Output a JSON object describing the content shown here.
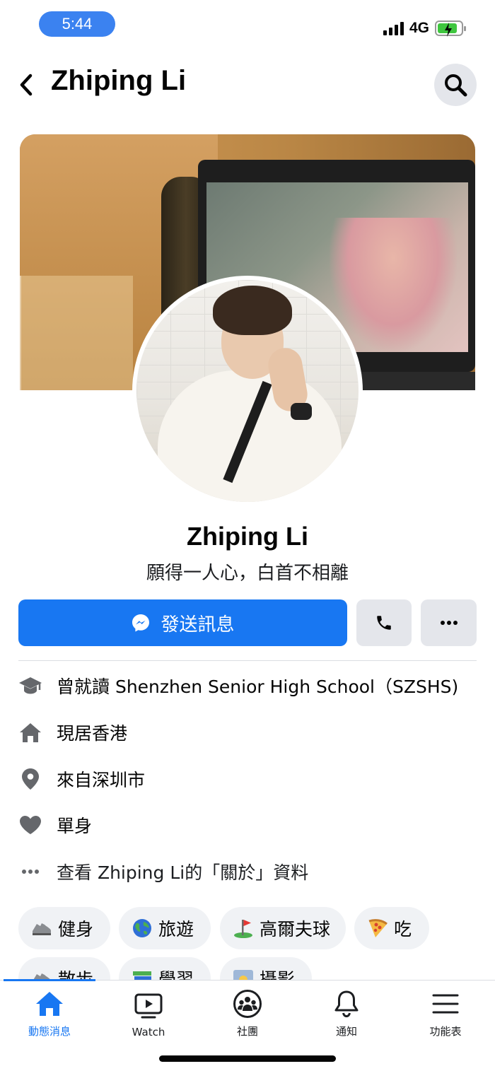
{
  "status_bar": {
    "time": "5:44",
    "network": "4G",
    "battery_level": 0.85
  },
  "header": {
    "title": "Zhiping Li",
    "back_icon": "chevron-left-icon",
    "search_icon": "search-icon"
  },
  "profile": {
    "name": "Zhiping Li",
    "bio": "願得一人心，白首不相離"
  },
  "actions": {
    "message_label": "發送訊息",
    "message_icon": "messenger-icon",
    "call_icon": "phone-icon",
    "more_icon": "more-dots-icon",
    "accent_color": "#1877f2"
  },
  "intro": {
    "education": "曾就讀 Shenzhen Senior High School（SZSHS)",
    "current_city": "現居香港",
    "hometown": "來自深圳市",
    "relationship": "單身",
    "see_about": "查看 Zhiping Li的「關於」資料"
  },
  "hobbies": [
    {
      "label": "健身",
      "icon": "running-shoe-icon"
    },
    {
      "label": "旅遊",
      "icon": "globe-icon"
    },
    {
      "label": "高爾夫球",
      "icon": "golf-flag-icon"
    },
    {
      "label": "吃",
      "icon": "pizza-icon"
    },
    {
      "label": "散步",
      "icon": "shoe-icon"
    },
    {
      "label": "學習",
      "icon": "books-icon"
    },
    {
      "label": "攝影",
      "icon": "sunrise-icon"
    }
  ],
  "tab_bar": {
    "items": [
      {
        "label": "動態消息",
        "icon": "home-icon",
        "active": true
      },
      {
        "label": "Watch",
        "icon": "watch-video-icon",
        "active": false
      },
      {
        "label": "社團",
        "icon": "groups-icon",
        "active": false
      },
      {
        "label": "通知",
        "icon": "bell-icon",
        "active": false
      },
      {
        "label": "功能表",
        "icon": "menu-icon",
        "active": false
      }
    ]
  }
}
